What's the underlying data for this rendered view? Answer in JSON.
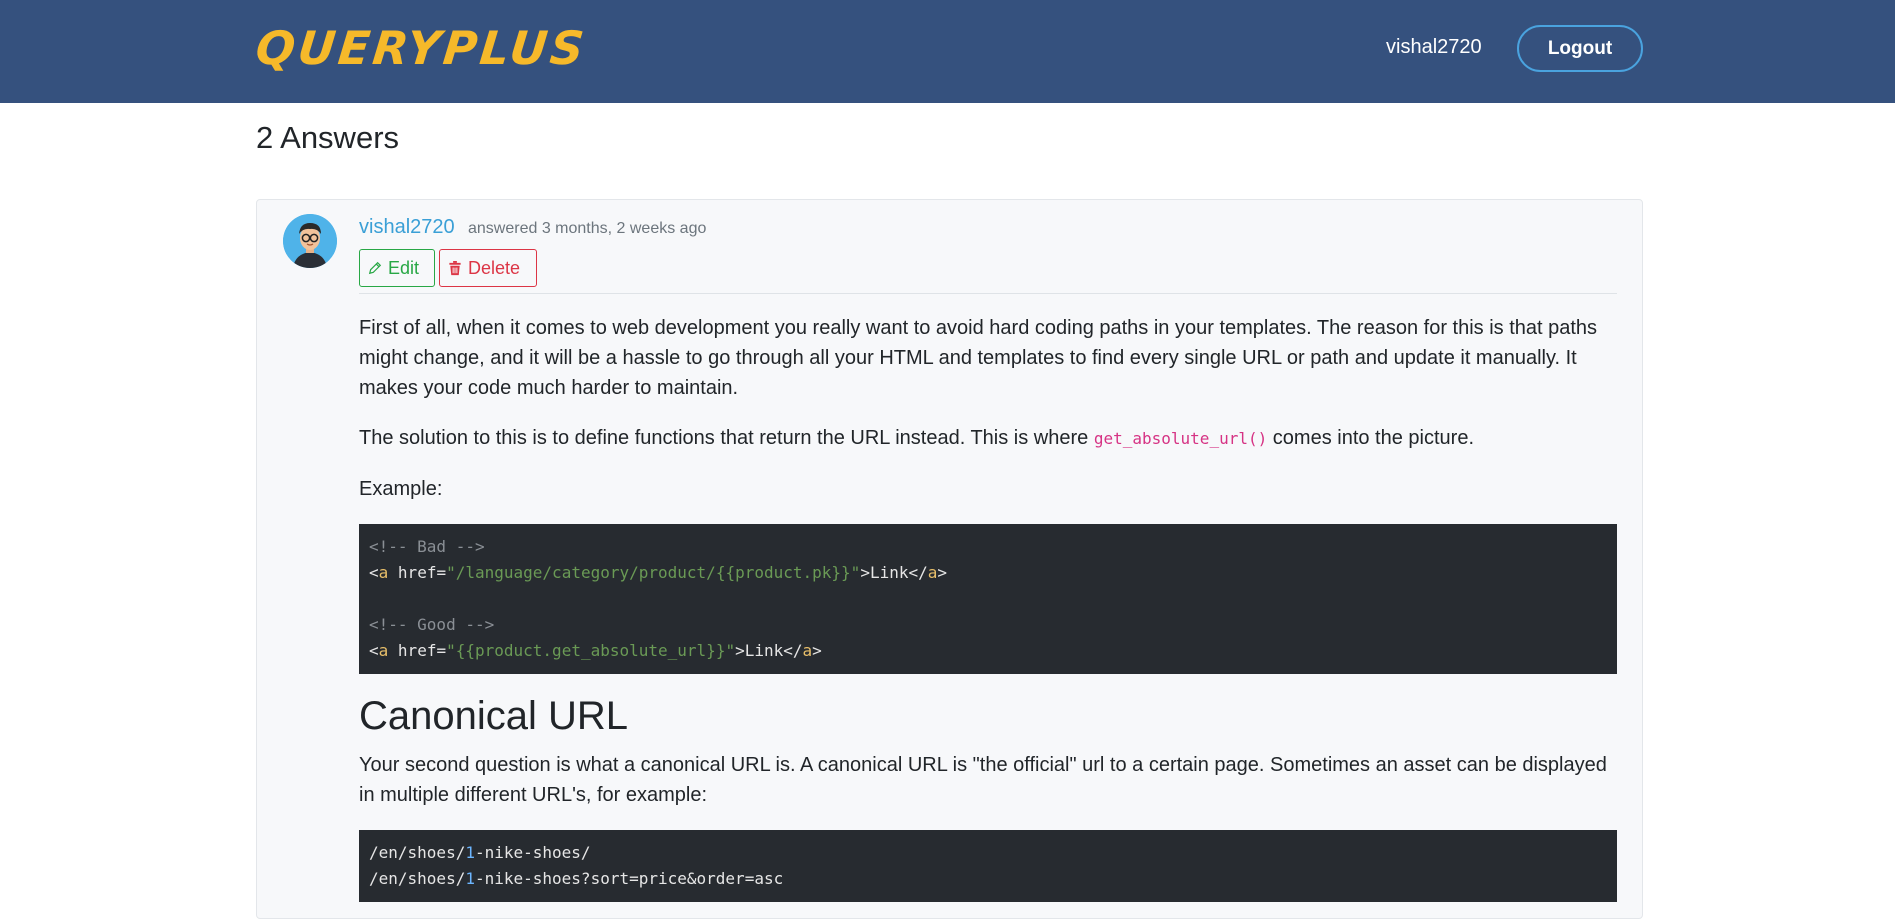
{
  "header": {
    "brand": "QUERYPLUS",
    "username": "vishal2720",
    "logout_label": "Logout"
  },
  "answers_heading": "2 Answers",
  "answer": {
    "username": "vishal2720",
    "meta": "answered 3 months, 2 weeks ago",
    "edit_label": "Edit",
    "delete_label": "Delete",
    "para1": "First of all, when it comes to web development you really want to avoid hard coding paths in your templates. The reason for this is that paths might change, and it will be a hassle to go through all your HTML and templates to find every single URL or path and update it manually. It makes your code much harder to maintain.",
    "para2_before": "The solution to this is to define functions that return the URL instead. This is where ",
    "para2_code": "get_absolute_url()",
    "para2_after": " comes into the picture.",
    "example_label": "Example:",
    "code1": {
      "comment_bad": "<!-- Bad -->",
      "bad_href": "\"/language/category/product/{{product.pk}}\"",
      "comment_good": "<!-- Good -->",
      "good_href": "\"{{product.get_absolute_url}}\"",
      "link_text": "Link"
    },
    "canonical_heading": "Canonical URL",
    "para3": "Your second question is what a canonical URL is. A canonical URL is \"the official\" url to a certain page. Sometimes an asset can be displayed in multiple different URL's, for example:",
    "code2": {
      "line1_a": "/en/shoes/",
      "line1_num": "1",
      "line1_b": "-nike-shoes/",
      "line2_a": "/en/shoes/",
      "line2_num": "1",
      "line2_b": "-nike-shoes?sort=price&order=asc"
    }
  },
  "colors": {
    "navbar": "#35517e",
    "brand": "#f6b92a",
    "link": "#3a9fd6",
    "edit": "#28a745",
    "delete": "#dc3545"
  }
}
